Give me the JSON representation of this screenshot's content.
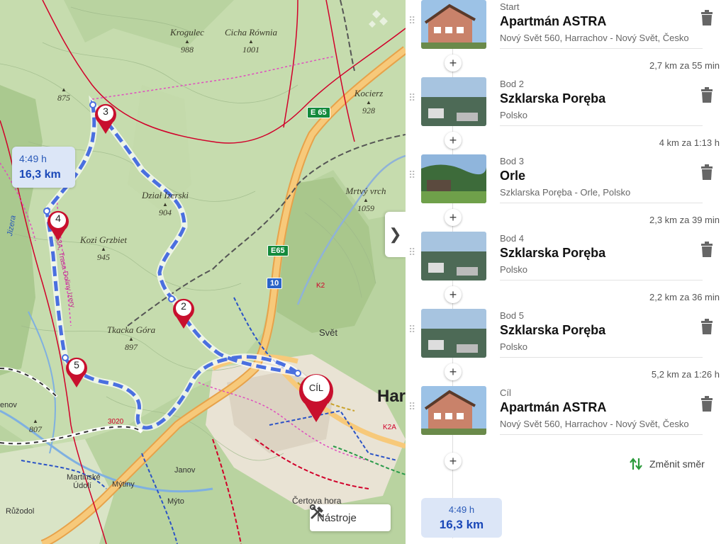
{
  "map": {
    "peaks": [
      {
        "name": "Krogulec",
        "elev": "988"
      },
      {
        "name": "Cicha Równia",
        "elev": "1001"
      },
      {
        "name": "",
        "elev": "875"
      },
      {
        "name": "Kocierz",
        "elev": "928"
      },
      {
        "name": "Dział Izerski",
        "elev": "904"
      },
      {
        "name": "Mrtvý vrch",
        "elev": "1059"
      },
      {
        "name": "Kozi Grzbiet",
        "elev": "945"
      },
      {
        "name": "Tkacka Góra",
        "elev": "897"
      },
      {
        "name": "",
        "elev": "807"
      }
    ],
    "places": [
      "Mýtiny",
      "Janov",
      "Martinské Údolí",
      "Mýto",
      "Růžodol",
      "Čertova hora",
      "Jizera",
      "enov",
      "Har",
      "Svět"
    ],
    "trail_label": "13A, Trasa Doliny Izery",
    "roads": [
      "E 65",
      "E65",
      "10",
      "K2",
      "K2A",
      "3020"
    ],
    "markers": [
      "3",
      "4",
      "2",
      "5",
      "CÍL"
    ],
    "route_bubble": {
      "time": "4:49 h",
      "distance": "16,3 km"
    },
    "tools_label": "Nástroje",
    "colors": {
      "route": "#4a6fe0",
      "marker": "#c8102e",
      "trail_red": "#d1002a"
    }
  },
  "panel": {
    "collapse_icon": "chevron-right-icon",
    "waypoints": [
      {
        "kind": "Start",
        "name": "Apartmán ASTRA",
        "addr": "Nový Svět 560, Harrachov - Nový Svět, Česko"
      },
      {
        "kind": "Bod 2",
        "name": "Szklarska Poręba",
        "addr": "Polsko"
      },
      {
        "kind": "Bod 3",
        "name": "Orle",
        "addr": "Szklarska Poręba - Orle, Polsko"
      },
      {
        "kind": "Bod 4",
        "name": "Szklarska Poręba",
        "addr": "Polsko"
      },
      {
        "kind": "Bod 5",
        "name": "Szklarska Poręba",
        "addr": "Polsko"
      },
      {
        "kind": "Cíl",
        "name": "Apartmán ASTRA",
        "addr": "Nový Svět 560, Harrachov - Nový Svět, Česko"
      }
    ],
    "segments": [
      "2,7 km za 55 min",
      "4 km za 1:13 h",
      "2,3 km za 39 min",
      "2,2 km za 36 min",
      "5,2 km za 1:26 h"
    ],
    "add_label": "+",
    "reverse_label": "Změnit směr",
    "summary": {
      "time": "4:49 h",
      "distance": "16,3 km"
    }
  }
}
